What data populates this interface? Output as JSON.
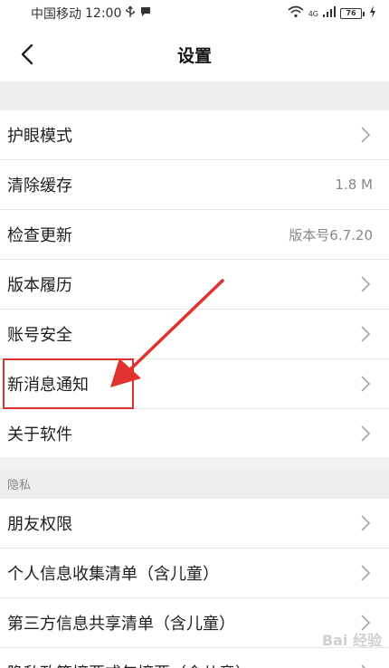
{
  "status_bar": {
    "carrier": "中国移动",
    "time": "12:00",
    "network": "4G",
    "battery": "76"
  },
  "header": {
    "title": "设置"
  },
  "settings": {
    "items": [
      {
        "label": "护眼模式"
      },
      {
        "label": "清除缓存",
        "value": "1.8 M"
      },
      {
        "label": "检查更新",
        "value": "版本号6.7.20"
      },
      {
        "label": "版本履历"
      },
      {
        "label": "账号安全"
      },
      {
        "label": "新消息通知"
      },
      {
        "label": "关于软件"
      }
    ]
  },
  "privacy": {
    "header": "隐私",
    "items": [
      {
        "label": "朋友权限"
      },
      {
        "label": "个人信息收集清单（含儿童）"
      },
      {
        "label": "第三方信息共享清单（含儿童）"
      },
      {
        "label": "隐私政策摘要或年摘要（含儿童）"
      }
    ]
  },
  "colors": {
    "annotation": "#e0322e",
    "divider": "#e6e6e6",
    "section_bg": "#eeeeee"
  },
  "watermark": "Bai 经验"
}
